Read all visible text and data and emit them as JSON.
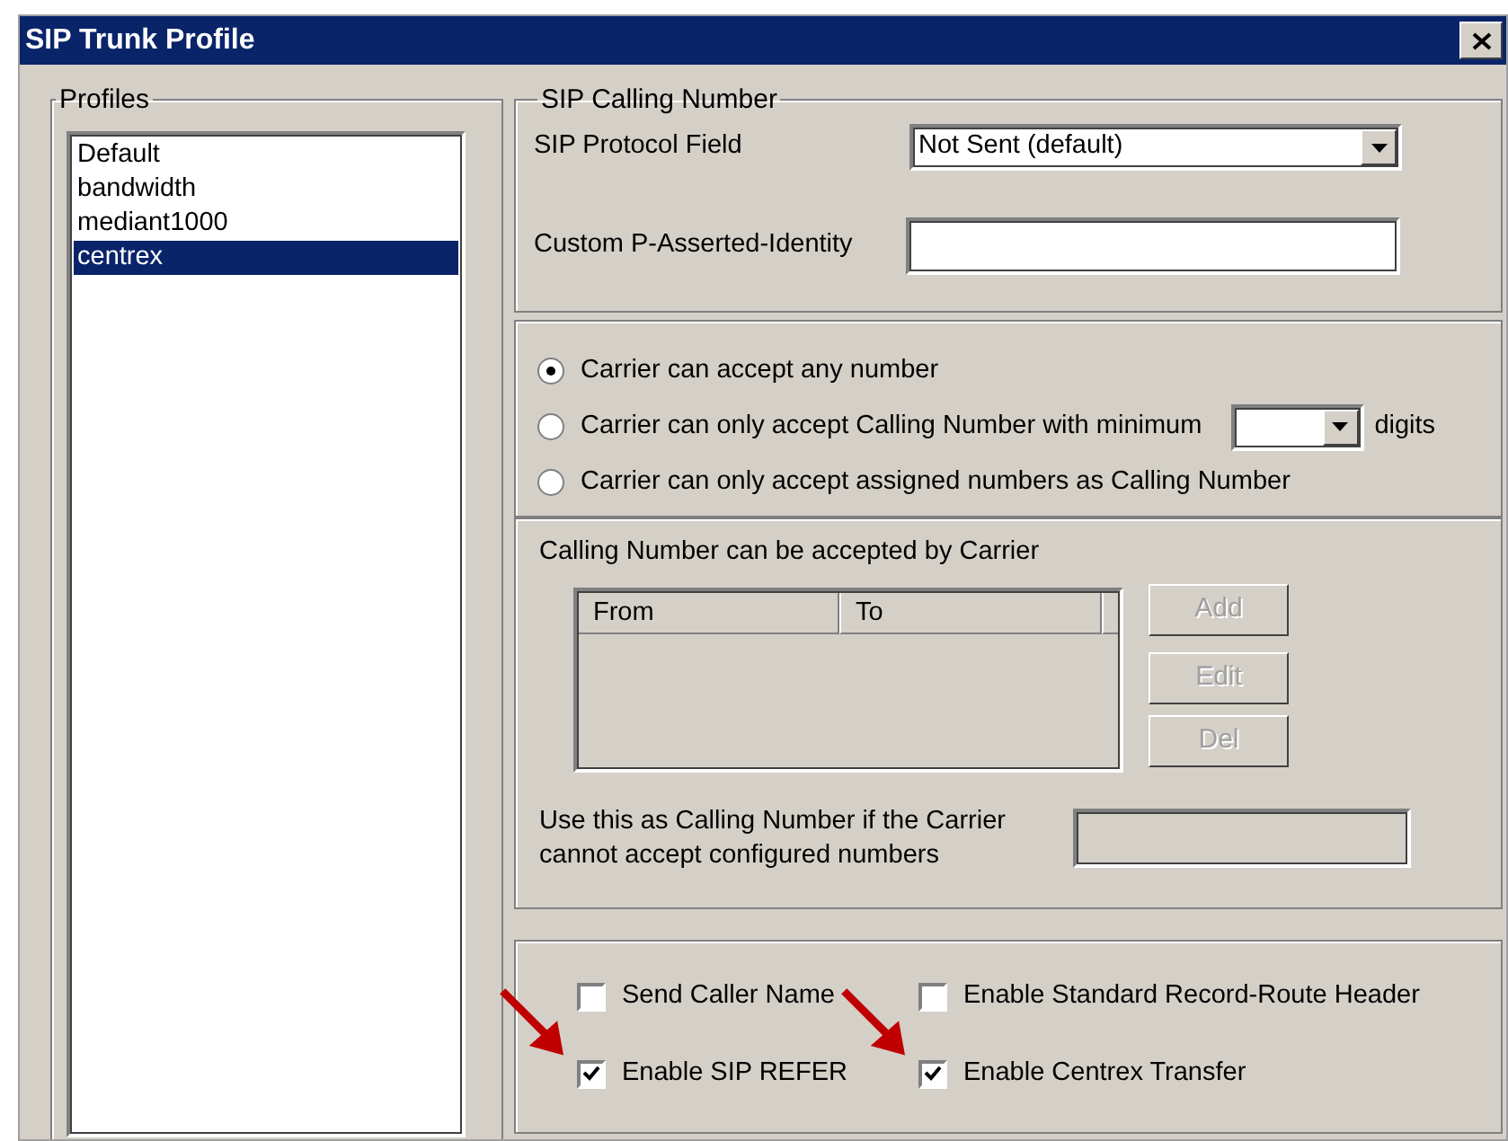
{
  "window": {
    "title": "SIP Trunk Profile"
  },
  "profiles": {
    "legend": "Profiles",
    "items": [
      {
        "label": "Default",
        "selected": false
      },
      {
        "label": "bandwidth",
        "selected": false
      },
      {
        "label": "mediant1000",
        "selected": false
      },
      {
        "label": "centrex",
        "selected": true
      }
    ]
  },
  "sip_calling_number": {
    "legend": "SIP Calling Number",
    "protocol_field": {
      "label": "SIP Protocol Field",
      "value": "Not Sent (default)"
    },
    "p_asserted_identity": {
      "label": "Custom P-Asserted-Identity"
    }
  },
  "carrier_options": [
    {
      "kind": "plain",
      "label": "Carrier can accept any number",
      "selected": true
    },
    {
      "kind": "min-digits",
      "label": "Carrier can only accept Calling Number with minimum",
      "suffix": "digits",
      "selected": false
    },
    {
      "kind": "plain",
      "label": "Carrier can only accept assigned numbers as Calling Number",
      "selected": false
    }
  ],
  "accepted_numbers": {
    "title": "Calling Number can be accepted by Carrier",
    "columns": [
      "From",
      "To"
    ],
    "buttons": [
      {
        "label": "Add",
        "disabled": true
      },
      {
        "label": "Edit",
        "disabled": true
      },
      {
        "label": "Del",
        "disabled": true
      }
    ],
    "fallback_label": "Use this as Calling Number if the Carrier\ncannot accept configured numbers"
  },
  "options": [
    {
      "label": "Send Caller Name",
      "checked": false,
      "arrow": false
    },
    {
      "label": "Enable Standard Record-Route Header",
      "checked": false,
      "arrow": false
    },
    {
      "label": "Enable SIP REFER",
      "checked": true,
      "arrow": true
    },
    {
      "label": "Enable Centrex Transfer",
      "checked": true,
      "arrow": true
    }
  ]
}
